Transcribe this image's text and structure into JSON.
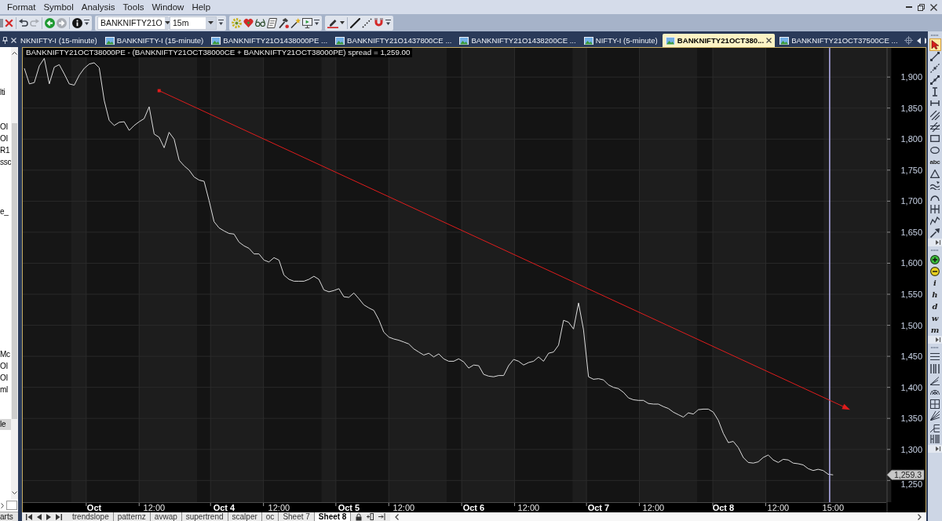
{
  "menu": [
    "Format",
    "Symbol",
    "Analysis",
    "Tools",
    "Window",
    "Help"
  ],
  "toolbar": {
    "buttons": [
      {
        "disabled": false
      },
      {
        "disabled": false
      },
      {
        "disabled": true
      },
      {
        "disabled": false
      },
      {
        "disabled": true
      },
      {
        "disabled": false
      }
    ],
    "symbol": {
      "value": "BANKNIFTY21O"
    },
    "interval": {
      "value": "15m"
    }
  },
  "tabs": [
    {
      "label": "NKNIFTY-I (15-minute)",
      "selected": false
    },
    {
      "label": "BANKNIFTY-I (15-minute)",
      "selected": false
    },
    {
      "label": "BANKNIFTY21O1438000PE ...",
      "selected": false
    },
    {
      "label": "BANKNIFTY21O1437800CE ...",
      "selected": false
    },
    {
      "label": "BANKNIFTY21O1438200CE ...",
      "selected": false
    },
    {
      "label": "NIFTY-I (5-minute)",
      "selected": false
    },
    {
      "label": "BANKNIFTY21OCT380...",
      "selected": true
    },
    {
      "label": "BANKNIFTY21OCT37500CE ...",
      "selected": false
    }
  ],
  "symbol_list": {
    "items": [
      {
        "label": "lti",
        "selected": false
      },
      {
        "label": "OI",
        "selected": false
      },
      {
        "label": "OI",
        "selected": false
      },
      {
        "label": "R1",
        "selected": false
      },
      {
        "label": "ssc",
        "selected": false
      },
      {
        "label": "e_",
        "selected": false
      },
      {
        "label": "Mc",
        "selected": false
      },
      {
        "label": "OI",
        "selected": false
      },
      {
        "label": "OI",
        "selected": false
      },
      {
        "label": "ml",
        "selected": false
      },
      {
        "label": "le",
        "selected": true
      }
    ],
    "tab": "arts"
  },
  "chart": {
    "chart_data": [
      {
        "type": "line",
        "title": "BANKNIFTY21OCT38000PE - (BANKNIFTY21OCT38000CE + BANKNIFTY21OCT38000PE) spread = 1,259.00",
        "categories": [
          null,
          null,
          null,
          null,
          null,
          null,
          null,
          null,
          null,
          null,
          null,
          null,
          null,
          null,
          "Oct",
          null,
          null,
          null,
          null,
          null,
          null,
          null,
          null,
          null,
          null,
          null,
          "12:00",
          null,
          null,
          null,
          null,
          null,
          null,
          null,
          null,
          null,
          null,
          null,
          null,
          null,
          "Oct 4",
          null,
          null,
          null,
          null,
          null,
          null,
          null,
          null,
          null,
          null,
          "12:00",
          null,
          null,
          null,
          null,
          null,
          null,
          null,
          null,
          null,
          null,
          null,
          null,
          null,
          "Oct 5",
          null,
          null,
          null,
          null,
          null,
          null,
          null,
          null,
          null,
          null,
          "12:00",
          null,
          null,
          null,
          null,
          null,
          null,
          null,
          null,
          null,
          null,
          null,
          null,
          null,
          "Oct 6",
          null,
          null,
          null,
          null,
          null,
          null,
          null,
          null,
          null,
          null,
          "12:00",
          null,
          null,
          null,
          null,
          null,
          null,
          null,
          null,
          null,
          null,
          null,
          null,
          null,
          "Oct 7",
          null,
          null,
          null,
          null,
          null,
          null,
          null,
          null,
          null,
          null,
          "12:00",
          null,
          null,
          null,
          null,
          null,
          null,
          null,
          null,
          null,
          null,
          null,
          null,
          null,
          "Oct 8",
          null,
          null,
          null,
          null,
          null,
          null,
          null,
          null,
          null,
          null,
          "12:00",
          null,
          null,
          null,
          null,
          null,
          null,
          null,
          null,
          null,
          null,
          "15:00"
        ],
        "color": "#dcdcdc",
        "values": [
          1914,
          1889,
          1891,
          1918,
          1930,
          1889,
          1916,
          1920,
          1905,
          1889,
          1887,
          1903,
          1914,
          1921,
          1923,
          1915,
          1862,
          1830,
          1822,
          1827,
          1828,
          1814,
          1822,
          1828,
          1833,
          1852,
          1808,
          1803,
          1786,
          1811,
          1800,
          1766,
          1757,
          1750,
          1739,
          1734,
          1732,
          1701,
          1667,
          1657,
          1652,
          1648,
          1647,
          1634,
          1628,
          1624,
          1615,
          1615,
          1605,
          1602,
          1609,
          1605,
          1581,
          1574,
          1571,
          1571,
          1571,
          1574,
          1579,
          1574,
          1557,
          1554,
          1556,
          1559,
          1546,
          1545,
          1552,
          1543,
          1533,
          1528,
          1524,
          1509,
          1489,
          1481,
          1478,
          1476,
          1473,
          1470,
          1462,
          1457,
          1452,
          1455,
          1449,
          1454,
          1446,
          1442,
          1442,
          1446,
          1441,
          1431,
          1436,
          1435,
          1421,
          1418,
          1417,
          1419,
          1419,
          1435,
          1445,
          1442,
          1436,
          1440,
          1442,
          1449,
          1442,
          1455,
          1457,
          1468,
          1508,
          1505,
          1494,
          1536,
          1493,
          1417,
          1413,
          1414,
          1412,
          1404,
          1400,
          1398,
          1392,
          1383,
          1380,
          1379,
          1379,
          1374,
          1373,
          1373,
          1369,
          1366,
          1360,
          1356,
          1352,
          1359,
          1357,
          1364,
          1365,
          1365,
          1360,
          1347,
          1326,
          1311,
          1313,
          1303,
          1287,
          1279,
          1278,
          1280,
          1287,
          1291,
          1283,
          1279,
          1284,
          1283,
          1278,
          1277,
          1275,
          1269,
          1266,
          1268,
          1266,
          1260,
          1259
        ],
        "ylim": [
          1215,
          1947
        ],
        "yticks": [
          {
            "value": 1250,
            "label": "1,250"
          },
          {
            "value": 1300,
            "label": "1,300"
          },
          {
            "value": 1350,
            "label": "1,350"
          },
          {
            "value": 1400,
            "label": "1,400"
          },
          {
            "value": 1450,
            "label": "1,450"
          },
          {
            "value": 1500,
            "label": "1,500"
          },
          {
            "value": 1550,
            "label": "1,550"
          },
          {
            "value": 1600,
            "label": "1,600"
          },
          {
            "value": 1650,
            "label": "1,650"
          },
          {
            "value": 1700,
            "label": "1,700"
          },
          {
            "value": 1750,
            "label": "1,750"
          },
          {
            "value": 1800,
            "label": "1,800"
          },
          {
            "value": 1850,
            "label": "1,850"
          },
          {
            "value": 1900,
            "label": "1,900"
          }
        ],
        "grid": true,
        "annotations": [
          "1,259.3"
        ]
      }
    ]
  },
  "drawing_toolbar": {
    "tools": [
      {
        "selected": true
      },
      {
        "selected": false
      },
      {
        "selected": false
      },
      {
        "selected": false
      },
      {
        "selected": false
      },
      {
        "selected": false
      },
      {
        "selected": false
      },
      {
        "selected": false
      },
      {
        "selected": false
      },
      {
        "selected": false
      },
      {
        "label": "abc",
        "selected": false
      },
      {
        "selected": false
      },
      {
        "selected": false
      },
      {
        "selected": false
      },
      {
        "selected": false
      },
      {
        "selected": false
      },
      {
        "selected": false
      }
    ],
    "intervals": [
      "i",
      "h",
      "d",
      "w",
      "m"
    ]
  },
  "sheet_tabs": [
    {
      "label": "trendslope",
      "selected": false
    },
    {
      "label": "patternz",
      "selected": false
    },
    {
      "label": "avwap",
      "selected": false
    },
    {
      "label": "supertrend",
      "selected": false
    },
    {
      "label": "scalper",
      "selected": false
    },
    {
      "label": "oc",
      "selected": false
    },
    {
      "label": "Sheet 7",
      "selected": false
    },
    {
      "label": "Sheet 8",
      "selected": true
    }
  ]
}
